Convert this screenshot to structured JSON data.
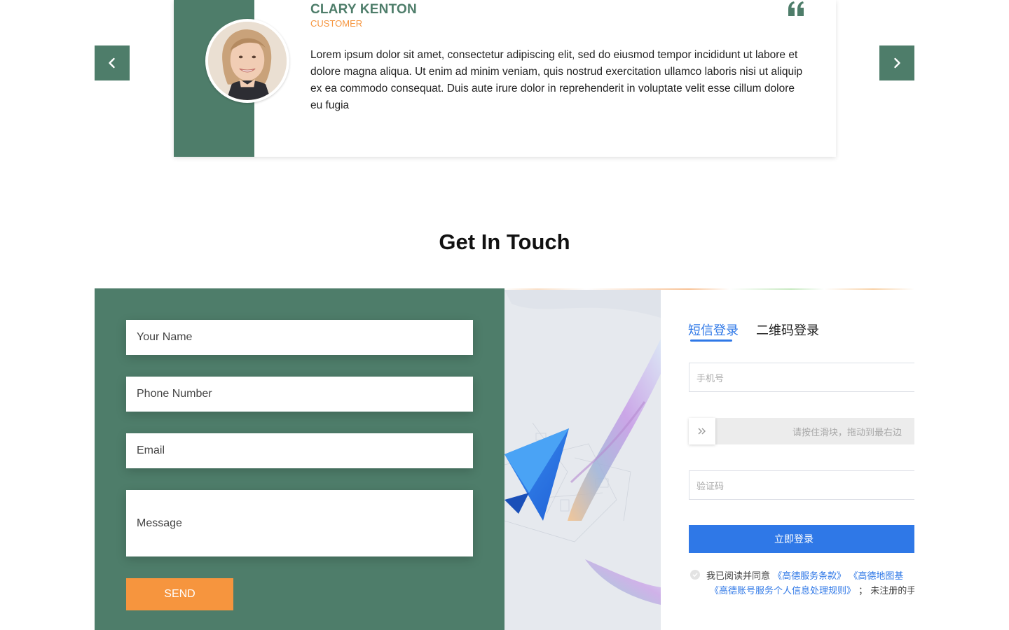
{
  "testimonial": {
    "name": "CLARY KENTON",
    "role": "CUSTOMER",
    "quote": "Lorem ipsum dolor sit amet, consectetur adipiscing elit, sed do eiusmod tempor incididunt ut labore et dolore magna aliqua. Ut enim ad minim veniam, quis nostrud exercitation ullamco laboris nisi ut aliquip ex ea commodo consequat. Duis aute irure dolor in reprehenderit in voluptate velit esse cillum dolore eu fugia"
  },
  "section": {
    "title": "Get In Touch"
  },
  "contact_form": {
    "name_placeholder": "Your Name",
    "phone_placeholder": "Phone Number",
    "email_placeholder": "Email",
    "message_placeholder": "Message",
    "send_label": "SEND"
  },
  "login": {
    "tab_sms": "短信登录",
    "tab_qr": "二维码登录",
    "phone_placeholder": "手机号",
    "slider_hint": "请按住滑块，拖动到最右边",
    "code_placeholder": "验证码",
    "submit_label": "立即登录",
    "agree_prefix": "我已阅读并同意",
    "agree_link1": "《高德服务条款》",
    "agree_link2": "《高德地图基",
    "agree_link3": "《高德账号服务个人信息处理规则》",
    "agree_suffix": "； 未注册的手"
  },
  "colors": {
    "brand_green": "#4e7d6a",
    "accent_orange": "#f6953e",
    "login_blue": "#2f78e7"
  },
  "icons": [
    "chevron-left-icon",
    "chevron-right-icon",
    "quote-icon",
    "double-chevron-right-icon",
    "check-circle-icon"
  ]
}
